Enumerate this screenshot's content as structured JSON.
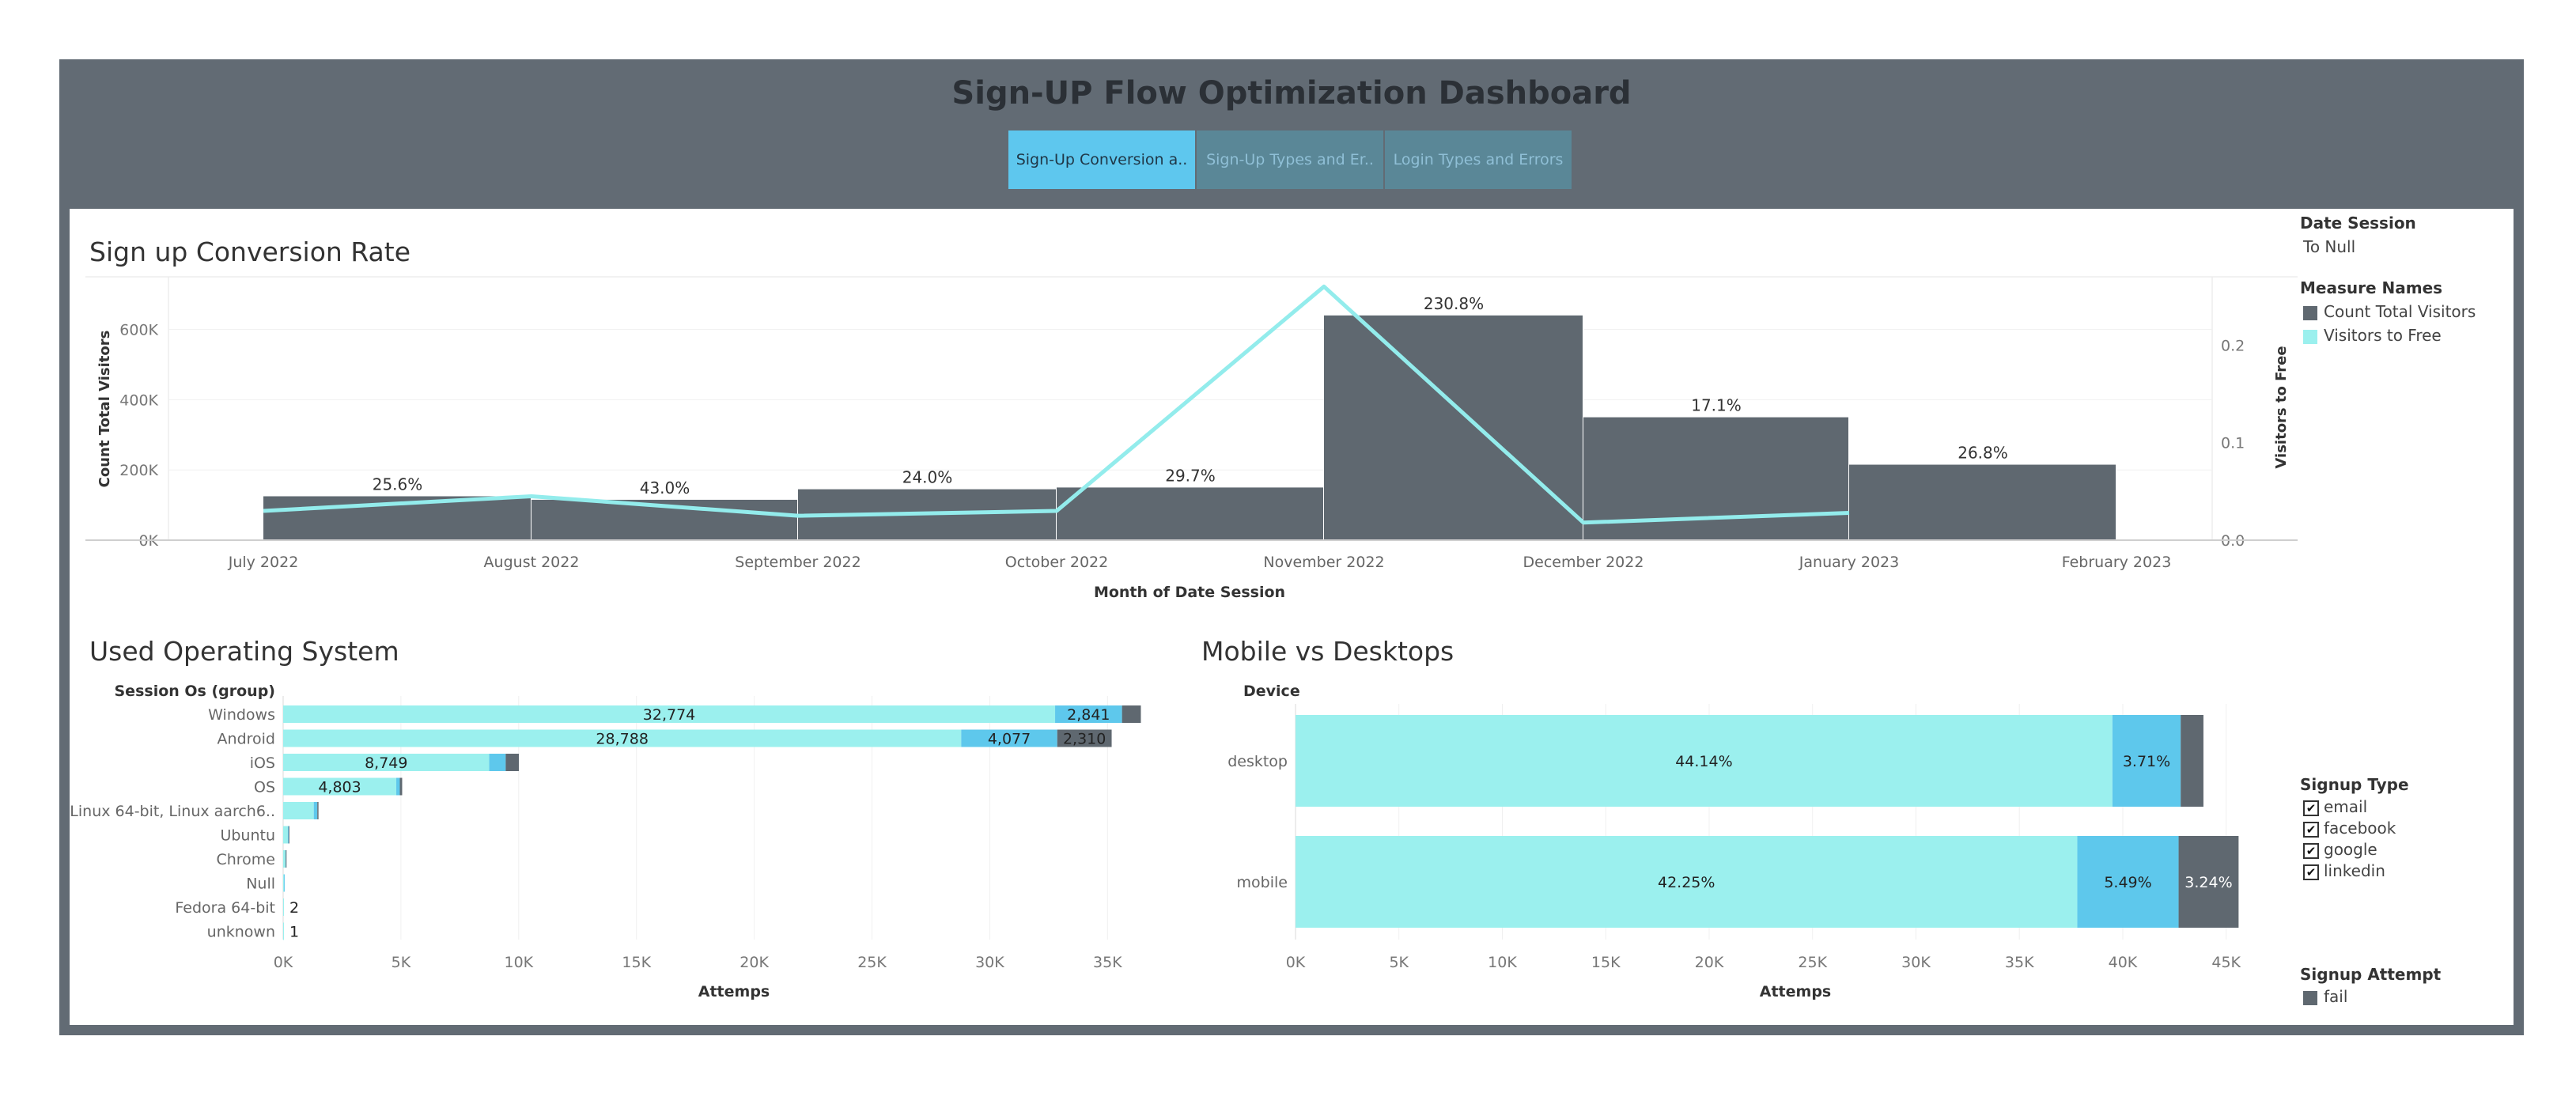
{
  "dashboard": {
    "title": "Sign-UP Flow Optimization Dashboard",
    "tabs": [
      {
        "label": "Sign-Up Conversion a..",
        "active": true
      },
      {
        "label": "Sign-Up Types and Er..",
        "active": false
      },
      {
        "label": "Login Types and Errors",
        "active": false
      }
    ]
  },
  "colors": {
    "frame": "#626b74",
    "bar_gray": "#5f6870",
    "line_cyan": "#93ecec",
    "seg_email": "#9bf0ee",
    "seg_facebook": "#5ec8ec",
    "seg_fail": "#5f6870"
  },
  "legend": {
    "date_session_title": "Date Session",
    "date_session_value": "To Null",
    "measure_names_title": "Measure Names",
    "measure_items": [
      "Count Total Visitors",
      "Visitors to Free"
    ],
    "signup_type_title": "Signup Type",
    "signup_types": [
      "email",
      "facebook",
      "google",
      "linkedin"
    ],
    "signup_attempt_title": "Signup Attempt",
    "signup_attempt_items": [
      "fail"
    ]
  },
  "chart_data": [
    {
      "type": "bar",
      "title": "Sign up Conversion Rate",
      "xlabel": "Month of Date Session",
      "ylabel": "Count Total Visitors",
      "y2label": "Visitors to Free",
      "categories": [
        "July 2022",
        "August 2022",
        "September 2022",
        "October 2022",
        "November 2022",
        "December 2022",
        "January 2023",
        "February 2023"
      ],
      "series": [
        {
          "name": "Count Total Visitors",
          "values": [
            125000,
            115000,
            145000,
            150000,
            640000,
            350000,
            215000
          ]
        },
        {
          "name": "Visitors to Free",
          "axis": "right",
          "values": [
            0.03,
            0.045,
            0.025,
            0.03,
            0.26,
            0.018,
            0.028
          ]
        }
      ],
      "bar_labels": [
        "25.6%",
        "43.0%",
        "24.0%",
        "29.7%",
        "230.8%",
        "17.1%",
        "26.8%"
      ],
      "ylim": [
        0,
        750000
      ],
      "yticks": [
        "0K",
        "200K",
        "400K",
        "600K"
      ],
      "y2lim": [
        0,
        0.27
      ],
      "y2ticks": [
        "0.0",
        "0.1",
        "0.2"
      ],
      "grid": true
    },
    {
      "type": "bar",
      "orientation": "horizontal",
      "stacked": true,
      "title": "Used Operating System",
      "row_header": "Session Os (group)",
      "xlabel": "Attemps",
      "categories": [
        "Windows",
        "Android",
        "iOS",
        "OS",
        "Linux 64-bit, Linux aarch6..",
        "Ubuntu",
        "Chrome",
        "Null",
        "Fedora 64-bit",
        "unknown"
      ],
      "series": [
        {
          "name": "email",
          "values": [
            32774,
            28788,
            8749,
            4803,
            1300,
            200,
            100,
            30,
            2,
            1
          ]
        },
        {
          "name": "facebook",
          "values": [
            2841,
            4077,
            700,
            150,
            150,
            30,
            10,
            5,
            0,
            0
          ]
        },
        {
          "name": "fail",
          "values": [
            800,
            2310,
            560,
            100,
            50,
            10,
            5,
            0,
            0,
            0
          ]
        }
      ],
      "bar_labels": [
        [
          "32,774",
          "2,841",
          ""
        ],
        [
          "28,788",
          "4,077",
          "2,310"
        ],
        [
          "8,749",
          "",
          ""
        ],
        [
          "4,803",
          "",
          ""
        ],
        [
          "",
          "",
          ""
        ],
        [
          "",
          "",
          ""
        ],
        [
          "",
          "",
          ""
        ],
        [
          "",
          "",
          ""
        ],
        [
          "2",
          "",
          ""
        ],
        [
          "1",
          "",
          ""
        ]
      ],
      "xlim": [
        0,
        36500
      ],
      "xticks": [
        "0K",
        "5K",
        "10K",
        "15K",
        "20K",
        "25K",
        "30K",
        "35K"
      ]
    },
    {
      "type": "bar",
      "orientation": "horizontal",
      "stacked": true,
      "title": "Mobile vs Desktops",
      "row_header": "Device",
      "xlabel": "Attemps",
      "categories": [
        "desktop",
        "mobile"
      ],
      "series": [
        {
          "name": "email",
          "values": [
            39500,
            37800
          ]
        },
        {
          "name": "facebook",
          "values": [
            3300,
            4900
          ]
        },
        {
          "name": "fail",
          "values": [
            1100,
            2900
          ]
        }
      ],
      "bar_labels": [
        [
          "44.14%",
          "3.71%",
          ""
        ],
        [
          "42.25%",
          "5.49%",
          "3.24%"
        ]
      ],
      "xlim": [
        0,
        47000
      ],
      "xticks": [
        "0K",
        "5K",
        "10K",
        "15K",
        "20K",
        "25K",
        "30K",
        "35K",
        "40K",
        "45K"
      ]
    }
  ]
}
